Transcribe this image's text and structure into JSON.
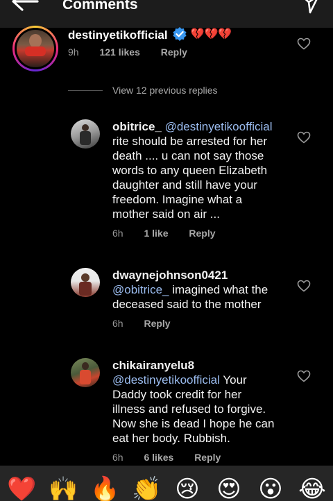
{
  "header": {
    "title": "Comments",
    "back_icon": "arrow-left-icon",
    "send_icon": "send-icon"
  },
  "main_comment": {
    "username": "destinyetikofficial",
    "verified": true,
    "broken_hearts": "💔💔💔",
    "time": "9h",
    "likes": "121 likes",
    "reply": "Reply"
  },
  "view_replies": "View 12 previous replies",
  "replies": [
    {
      "username": "obitrice_",
      "mention": "@destinyetikoofficial",
      "lines": [
        "rite should be arrested for her",
        "death .... u can not say those",
        "words to any queen Elizabeth",
        "daughter and still have your",
        "freedom. Imagine what a",
        "mother said on air ..."
      ],
      "time": "6h",
      "likes": "1 like",
      "reply": "Reply"
    },
    {
      "username": "dwaynejohnson0421",
      "mention": "@obitrice_",
      "first_line_rest": " imagined what the",
      "lines": [
        "deceased said to the mother"
      ],
      "time": "6h",
      "reply": "Reply"
    },
    {
      "username": "chikairanyelu8",
      "mention": "@destinyetikoofficial",
      "first_line_rest": " Your",
      "lines": [
        "Daddy took credit for her",
        "illness and refused to forgive.",
        "Now she is dead I hope he can",
        "eat her body. Rubbish."
      ],
      "time": "6h",
      "likes": "6 likes",
      "reply": "Reply"
    }
  ],
  "emoji_bar": [
    "❤️",
    "🙌",
    "🔥",
    "👏",
    "😢",
    "😍",
    "😮",
    "😂"
  ],
  "colors": {
    "background": "#000000",
    "header": "#1c1c1c",
    "mention": "#9bbcef",
    "muted": "#9a9a9a",
    "verified": "#3897f0",
    "story_ring": "#d6249f"
  }
}
